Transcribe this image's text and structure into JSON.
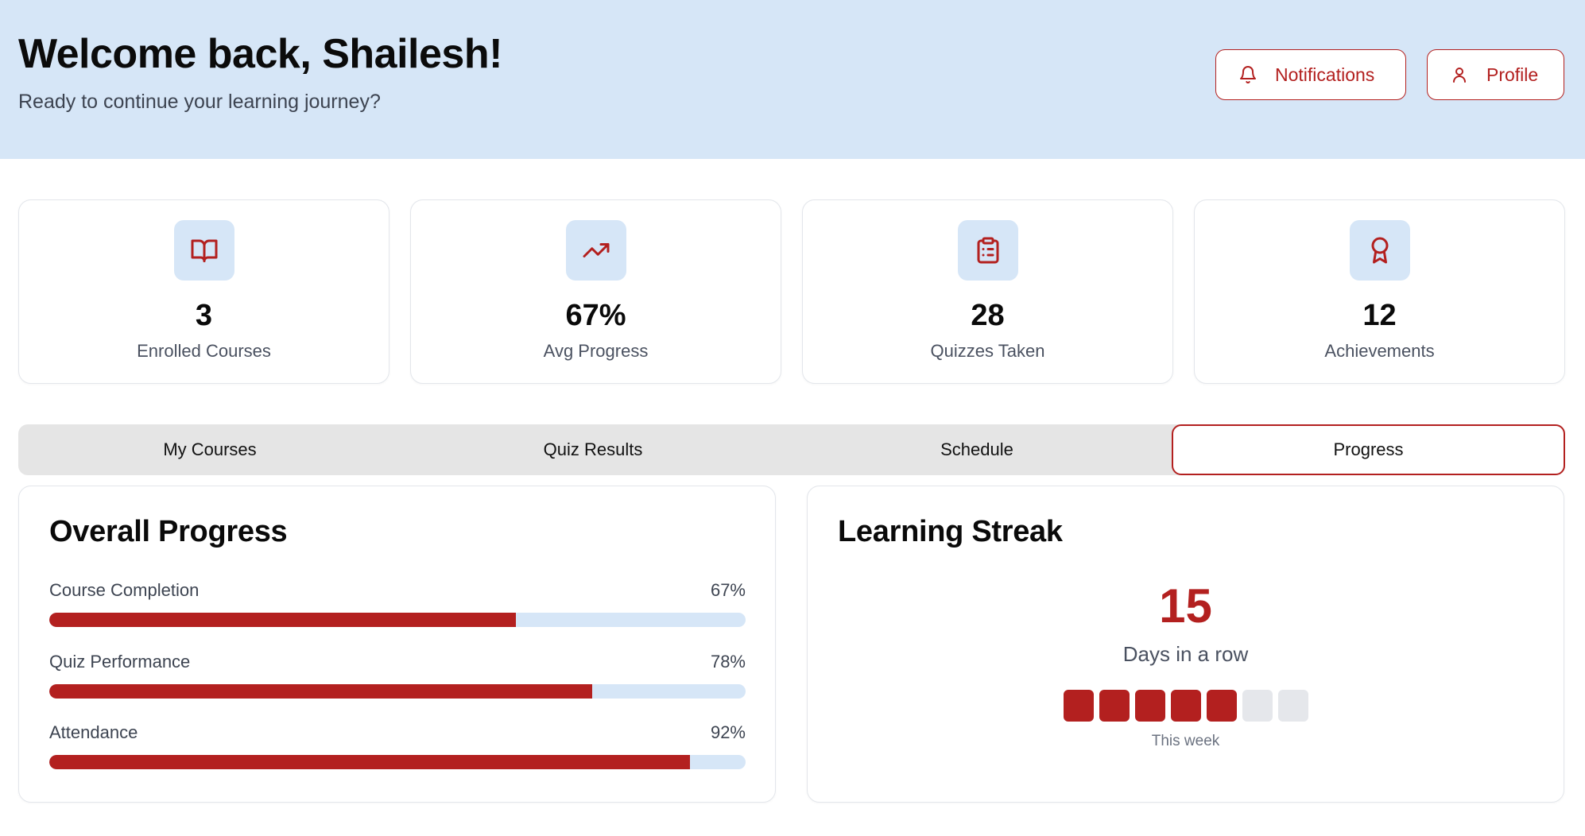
{
  "header": {
    "title": "Welcome back, Shailesh!",
    "subtitle": "Ready to continue your learning journey?",
    "notifications_label": "Notifications",
    "profile_label": "Profile",
    "notifications_icon": "bell-icon",
    "profile_icon": "user-icon"
  },
  "stats": [
    {
      "icon": "book-open-icon",
      "value": "3",
      "label": "Enrolled Courses"
    },
    {
      "icon": "trending-up-icon",
      "value": "67%",
      "label": "Avg Progress"
    },
    {
      "icon": "clipboard-list-icon",
      "value": "28",
      "label": "Quizzes Taken"
    },
    {
      "icon": "award-icon",
      "value": "12",
      "label": "Achievements"
    }
  ],
  "tabs": [
    {
      "label": "My Courses"
    },
    {
      "label": "Quiz Results"
    },
    {
      "label": "Schedule"
    },
    {
      "label": "Progress",
      "active": true
    }
  ],
  "overall_progress": {
    "title": "Overall Progress",
    "items": [
      {
        "label": "Course Completion",
        "value_text": "67%",
        "value": 0.67
      },
      {
        "label": "Quiz Performance",
        "value_text": "78%",
        "value": 0.78
      },
      {
        "label": "Attendance",
        "value_text": "92%",
        "value": 0.92
      }
    ]
  },
  "learning_streak": {
    "title": "Learning Streak",
    "days_count": "15",
    "days_label": "Days in a row",
    "week": [
      true,
      true,
      true,
      true,
      true,
      false,
      false
    ],
    "week_label": "This week"
  },
  "colors": {
    "accent": "#b3201f",
    "header_bg": "#d6e6f7",
    "track": "#d6e6f7",
    "inactive_day": "#e5e7eb"
  }
}
